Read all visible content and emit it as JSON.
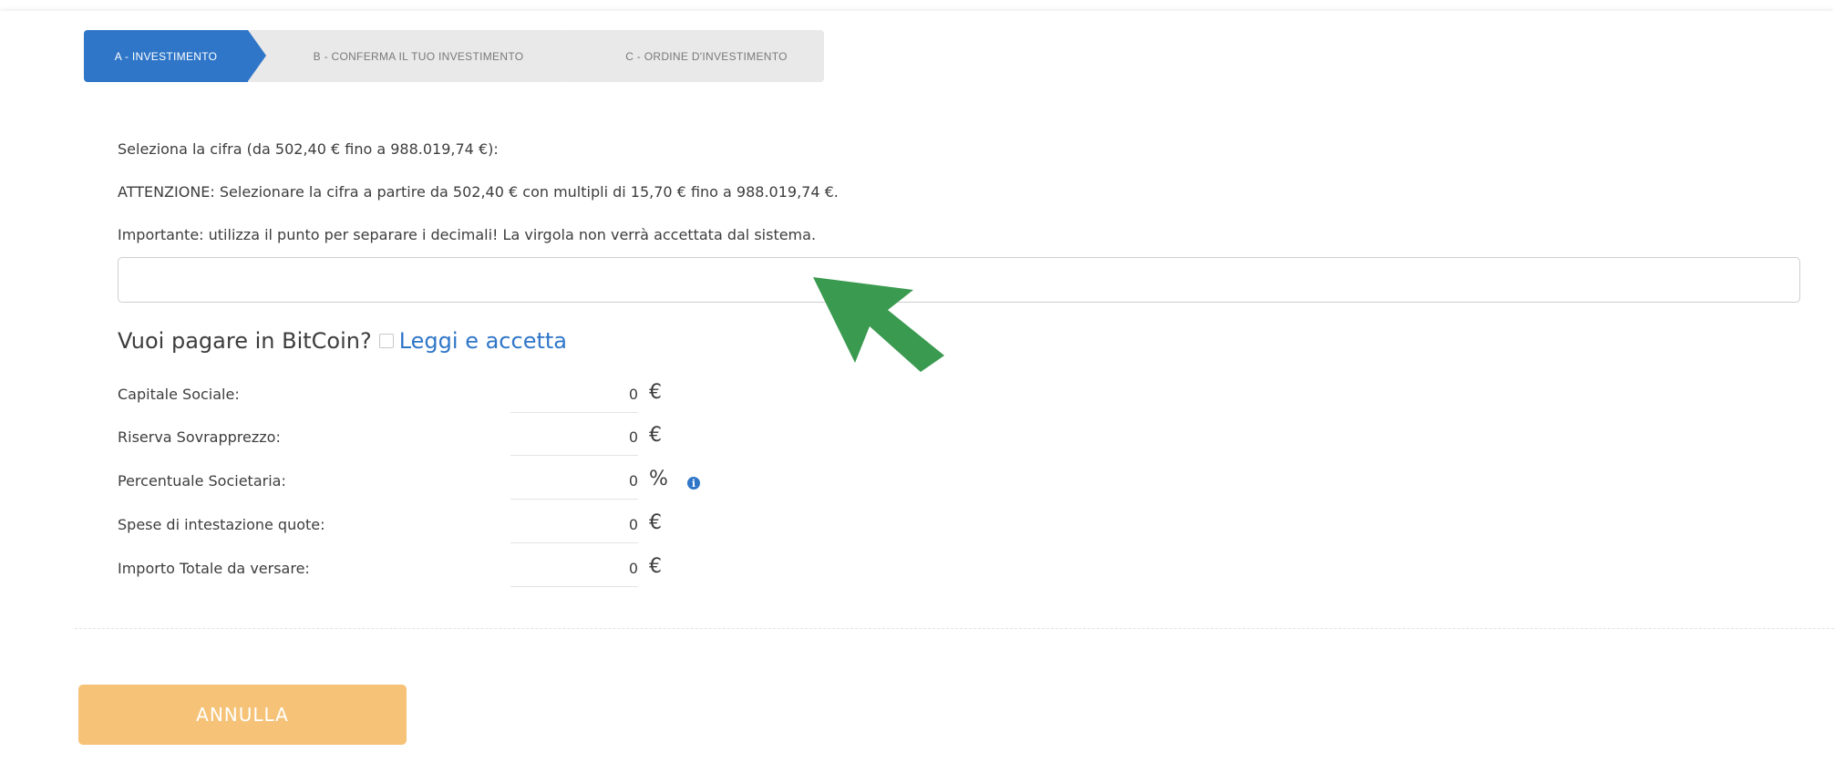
{
  "stepper": {
    "steps": [
      {
        "label": "A - INVESTIMENTO",
        "state": "active"
      },
      {
        "label": "B - CONFERMA IL TUO INVESTIMENTO",
        "state": "inactive"
      },
      {
        "label": "C - ORDINE D'INVESTIMENTO",
        "state": "inactive"
      }
    ]
  },
  "form": {
    "range_text": "Seleziona la cifra (da 502,40 € fino a 988.019,74 €):",
    "warning_text": "ATTENZIONE: Selezionare la cifra a partire da 502,40 € con multipli di 15,70 € fino a 988.019,74 €.",
    "note_text": "Importante: utilizza il punto per separare i decimali! La virgola non verrà accettata dal sistema.",
    "amount_value": "",
    "amount_placeholder": ""
  },
  "bitcoin": {
    "question": "Vuoi pagare in BitCoin?",
    "checked": false,
    "link_label": "Leggi e accetta"
  },
  "summary": {
    "rows": [
      {
        "label": "Capitale Sociale:",
        "value": "0",
        "unit": "€"
      },
      {
        "label": "Riserva Sovrapprezzo:",
        "value": "0",
        "unit": "€"
      },
      {
        "label": "Percentuale Societaria:",
        "value": "0",
        "unit": "%"
      },
      {
        "label": "Spese di intestazione quote:",
        "value": "0",
        "unit": "€"
      },
      {
        "label": "Importo Totale da versare:",
        "value": "0",
        "unit": "€"
      }
    ],
    "info_icon": "info-icon"
  },
  "actions": {
    "cancel_label": "ANNULLA"
  },
  "colors": {
    "accent": "#2f76c8",
    "cancel": "#f5c277",
    "arrow": "#3a9a50"
  }
}
